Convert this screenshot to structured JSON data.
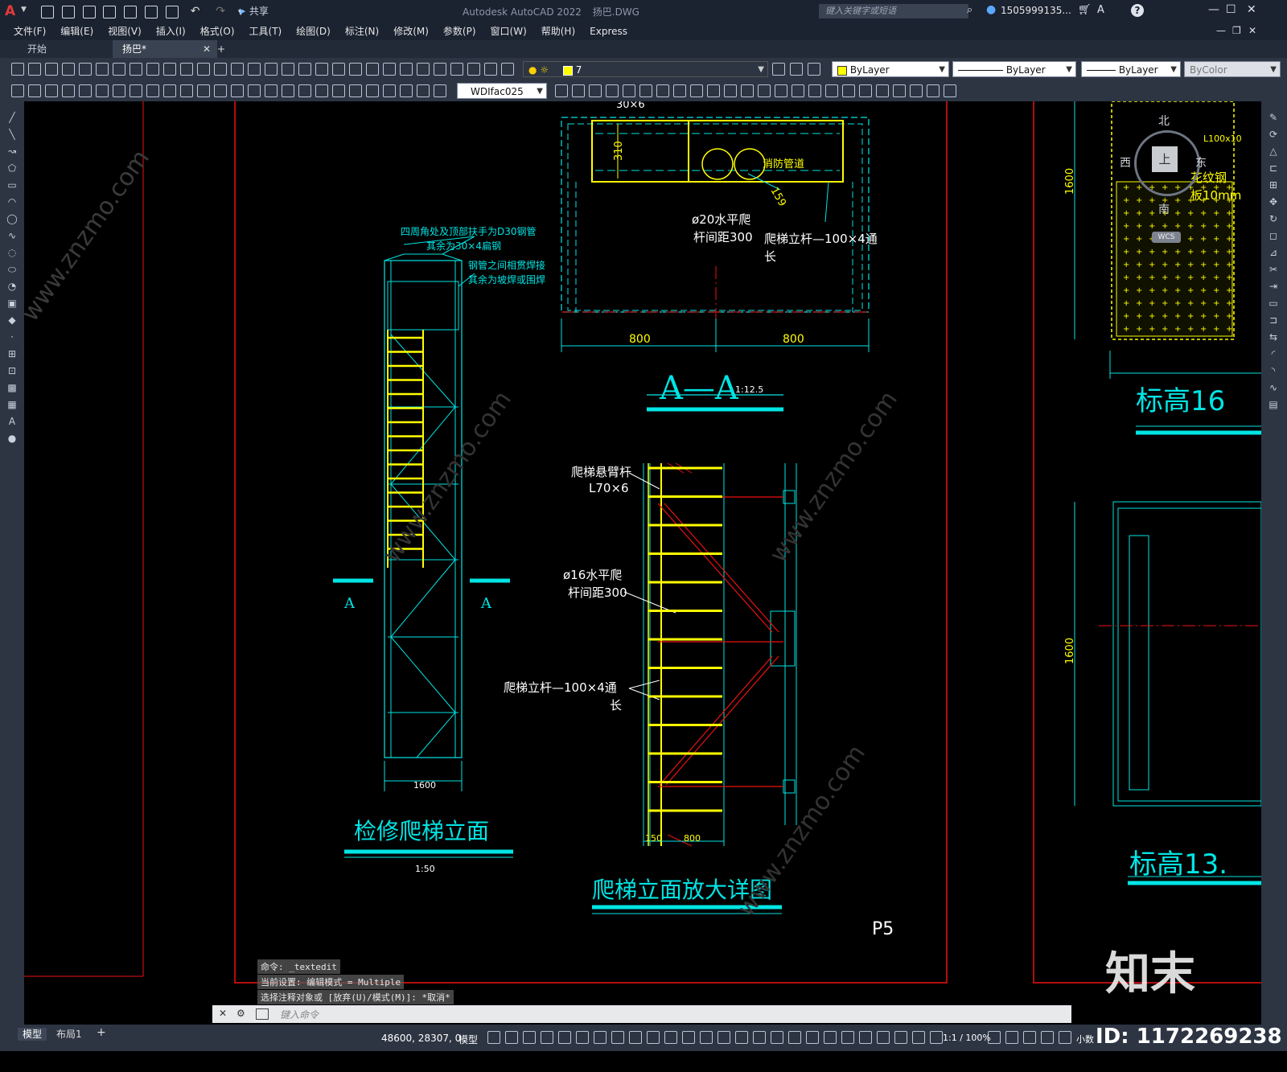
{
  "app": {
    "title": "Autodesk AutoCAD 2022",
    "file": "扬巴.DWG",
    "share_label": "共享",
    "search_placeholder": "键入关键字或短语",
    "user": "1505999135...",
    "help": "?",
    "logo": "A"
  },
  "menu": [
    "文件(F)",
    "编辑(E)",
    "视图(V)",
    "插入(I)",
    "格式(O)",
    "工具(T)",
    "绘图(D)",
    "标注(N)",
    "修改(M)",
    "参数(P)",
    "窗口(W)",
    "帮助(H)",
    "Express"
  ],
  "tabs": [
    {
      "label": "开始"
    },
    {
      "label": "扬巴*"
    }
  ],
  "layer_combo": "7",
  "color_combo": "ByLayer",
  "linetype_combo": "ByLayer",
  "lineweight_combo": "ByLayer",
  "plotstyle_combo": "ByColor",
  "textstyle_combo": "WDIfac025",
  "drawing": {
    "section_title": "A—A",
    "section_scale": "1:12.5",
    "fire_pipe": "消防管道",
    "dim_310": "310",
    "dim_159": "159",
    "dim_30x6": "30×6",
    "note_phi20": "ø20水平爬",
    "note_phi20_b": "杆间距300",
    "note_riser_top": "爬梯立杆—100×4通",
    "note_riser_top_b": "长",
    "dim_800_left": "800",
    "dim_800_right": "800",
    "handrail_note1": "四周角处及顶部扶手为D30钢管",
    "handrail_note2": "其余为30×4扁钢",
    "weld_note1": "钢管之间相贯焊接",
    "weld_note2": "其余为坡焊或围焊",
    "section_mark": "A",
    "elev_title": "检修爬梯立面",
    "elev_scale": "1:50",
    "dim_1600": "1600",
    "cantilever1": "爬梯悬臂杆",
    "cantilever2": "L70×6",
    "phi16_1": "ø16水平爬",
    "phi16_2": "杆间距300",
    "riser_1": "爬梯立杆—100×4通",
    "riser_2": "长",
    "detail_title": "爬梯立面放大详图",
    "dim_150": "150",
    "dim_800b": "800",
    "page_label": "P5",
    "right_top_title": "标高16",
    "right_bottom_title": "标高13.",
    "right_dim1": "1600",
    "right_dim2": "1600",
    "right_note1": "L100x10",
    "right_note2": "花纹钢",
    "right_note3": "板10mm"
  },
  "viewcube": {
    "north": "北",
    "south": "南",
    "east": "东",
    "west": "西",
    "top": "上",
    "wcs": "WCS"
  },
  "command": {
    "line1": "命令: _textedit",
    "line2": "当前设置: 编辑模式 = Multiple",
    "line3": "选择注释对象或 [放弃(U)/模式(M)]: *取消*",
    "placeholder": "键入命令"
  },
  "status": {
    "model_tab": "模型",
    "layout_tab": "布局1",
    "coords": "48600, 28307, 0",
    "model": "模型",
    "scale": "1:1 / 100%",
    "units": "小数"
  },
  "watermark": {
    "brand": "知末",
    "id": "ID: 1172269238",
    "site": "www.znzmo.com"
  }
}
